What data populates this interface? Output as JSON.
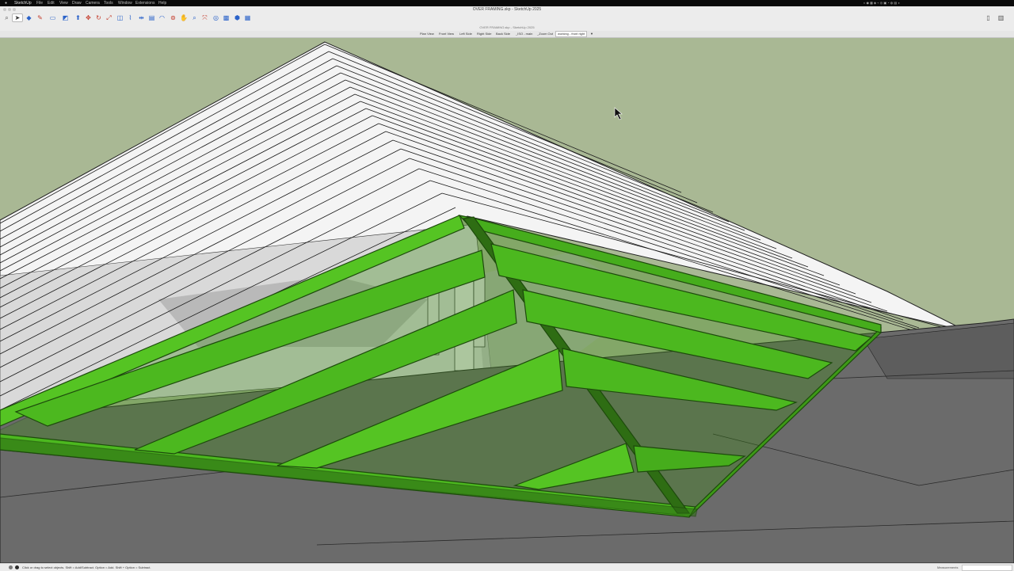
{
  "menubar": {
    "items": [
      "SketchUp",
      "File",
      "Edit",
      "View",
      "Draw",
      "Camera",
      "Tools",
      "Window",
      "Extensions",
      "Help"
    ]
  },
  "window": {
    "title": "OVER FRAMING.skp - SketchUp 2025"
  },
  "document": {
    "name": "OVER FRAMING.skp - SketchUp 2025"
  },
  "toolbar": {
    "tools": [
      "search-icon",
      "select-arrow-icon",
      "paint-bucket-icon",
      "pencil-icon",
      "rectangle-icon",
      "eraser-icon",
      "push-pull-icon",
      "move-icon",
      "rotate-icon",
      "scale-icon",
      "offset-icon",
      "tape-measure-icon",
      "dimension-icon",
      "text-icon",
      "protractor-icon",
      "orbit-icon",
      "pan-icon",
      "zoom-icon",
      "zoom-extents-icon",
      "x-ray-icon",
      "section-plane-icon",
      "components-icon"
    ]
  },
  "scenes": {
    "tabs": [
      "Plan View",
      "Front View",
      "Left Side",
      "Right Side",
      "Back Side",
      "_ISO - main",
      "_Zoom Out",
      "working - front right"
    ],
    "active_index": 7
  },
  "statusbar": {
    "text": "Click or drag to select objects. Shift = Add/Subtract. Option = Add. Shift + Option = Subtract.",
    "measurements_label": "Measurements",
    "measurements_value": ""
  },
  "colors": {
    "sky": "#a9b894",
    "framing_green": "#4cb81f",
    "framing_green_dark": "#2d6d14",
    "ground": "#6b6b6b",
    "rafter": "#ffffff"
  }
}
